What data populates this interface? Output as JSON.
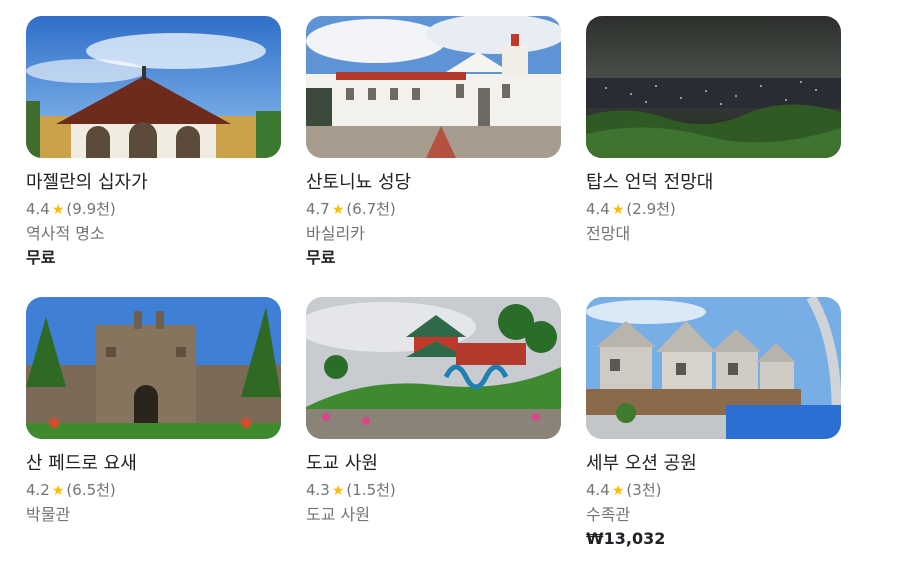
{
  "cards": [
    {
      "title": "마젤란의 십자가",
      "rating": "4.4",
      "reviews": "(9.9천)",
      "category": "역사적 명소",
      "price": "무료",
      "photo": "magellans-cross-photo"
    },
    {
      "title": "산토니뇨 성당",
      "rating": "4.7",
      "reviews": "(6.7천)",
      "category": "바실리카",
      "price": "무료",
      "photo": "santo-nino-basilica-photo"
    },
    {
      "title": "탑스 언덕 전망대",
      "rating": "4.4",
      "reviews": "(2.9천)",
      "category": "전망대",
      "price": "",
      "photo": "tops-lookout-photo"
    },
    {
      "title": "산 페드로 요새",
      "rating": "4.2",
      "reviews": "(6.5천)",
      "category": "박물관",
      "price": "",
      "photo": "fort-san-pedro-photo"
    },
    {
      "title": "도교 사원",
      "rating": "4.3",
      "reviews": "(1.5천)",
      "category": "도교 사원",
      "price": "",
      "photo": "taoist-temple-photo"
    },
    {
      "title": "세부 오션 공원",
      "rating": "4.4",
      "reviews": "(3천)",
      "category": "수족관",
      "price": "₩13,032",
      "photo": "cebu-ocean-park-photo"
    }
  ],
  "star_icon": "star-icon",
  "colors": {
    "star": "#fbbc04",
    "secondary_text": "#70757a",
    "primary_text": "#202124"
  }
}
